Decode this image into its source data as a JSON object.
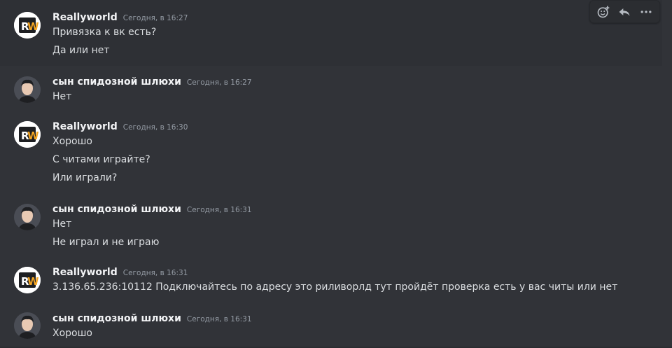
{
  "toolbar": {
    "add_reaction_icon": "add-reaction-icon",
    "reply_icon": "reply-icon",
    "more_icon": "more-icon"
  },
  "colors": {
    "background": "#313338",
    "username": "#f2f3f5",
    "timestamp": "#949ba4",
    "text": "#dbdee1",
    "rw_logo_orange": "#f5a623"
  },
  "messages": [
    {
      "author": "Reallyworld",
      "timestamp": "Сегодня, в 16:27",
      "lines": [
        "Привязка к вк есть?",
        "Да или нет"
      ]
    },
    {
      "author": "сын  спидозной шлюхи",
      "timestamp": "Сегодня, в 16:27",
      "lines": [
        "Нет"
      ]
    },
    {
      "author": "Reallyworld",
      "timestamp": "Сегодня, в 16:30",
      "lines": [
        "Хорошо",
        "С читами играйте?",
        "Или играли?"
      ]
    },
    {
      "author": "сын  спидозной шлюхи",
      "timestamp": "Сегодня, в 16:31",
      "lines": [
        "Нет",
        "Не играл и не играю"
      ]
    },
    {
      "author": "Reallyworld",
      "timestamp": "Сегодня, в 16:31",
      "lines": [
        "3.136.65.236:10112 Подключайтесь по адресу это риливорлд тут пройдёт проверка есть у вас читы или нет"
      ]
    },
    {
      "author": "сын  спидозной шлюхи",
      "timestamp": "Сегодня, в 16:31",
      "lines": [
        "Хорошо"
      ]
    }
  ]
}
